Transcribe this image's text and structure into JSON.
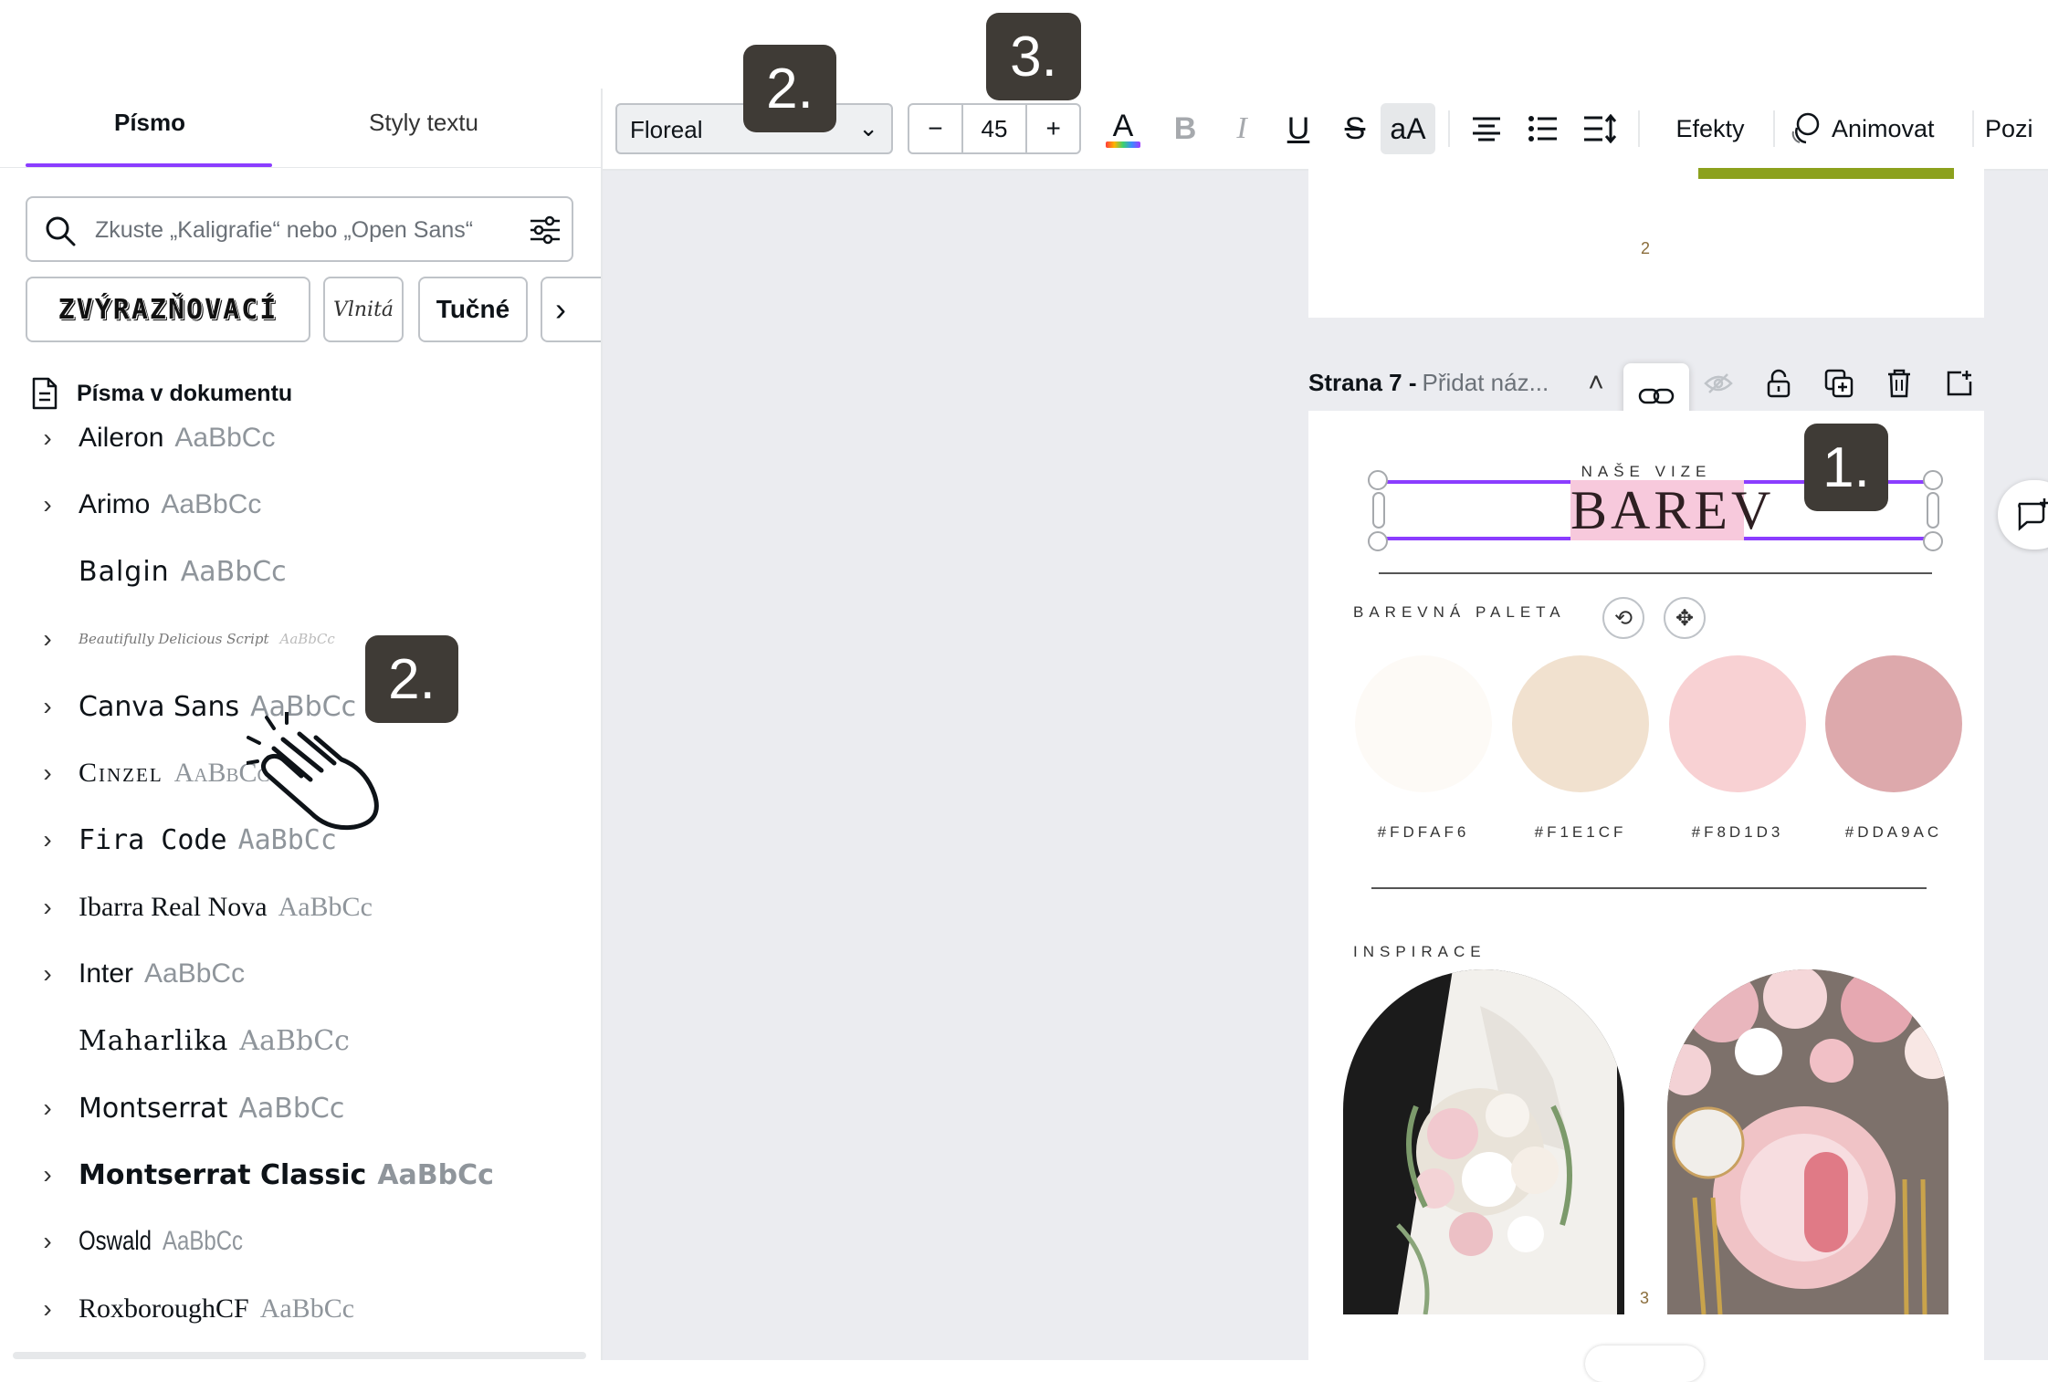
{
  "left_panel": {
    "tabs": [
      {
        "label": "Písmo",
        "active": true
      },
      {
        "label": "Styly textu",
        "active": false
      }
    ],
    "search": {
      "placeholder": "Zkuste „Kaligrafie“ nebo „Open Sans“",
      "value": ""
    },
    "chips": [
      "ZVÝRAZŇOVACÍ",
      "Vlnitá",
      "Tučné"
    ],
    "document_fonts_label": "Písma v dokumentu",
    "fonts": [
      {
        "name": "Aileron",
        "sample": "AaBbCc",
        "expandable": true
      },
      {
        "name": "Arimo",
        "sample": "AaBbCc",
        "expandable": true
      },
      {
        "name": "Balgin",
        "sample": "AaBbCc",
        "expandable": false
      },
      {
        "name": "Beautifully Delicious Script",
        "sample": "AaBbCc",
        "expandable": true
      },
      {
        "name": "Canva Sans",
        "sample": "AaBbCc",
        "expandable": true
      },
      {
        "name": "Cinzel",
        "sample": "AaBbCc",
        "expandable": true
      },
      {
        "name": "Fira Code",
        "sample": "AaBbCc",
        "expandable": true
      },
      {
        "name": "Ibarra Real Nova",
        "sample": "AaBbCc",
        "expandable": true
      },
      {
        "name": "Inter",
        "sample": "AaBbCc",
        "expandable": true
      },
      {
        "name": "Maharlika",
        "sample": "AaBbCc",
        "expandable": false
      },
      {
        "name": "Montserrat",
        "sample": "AaBbCc",
        "expandable": true
      },
      {
        "name": "Montserrat Classic",
        "sample": "AaBbCc",
        "expandable": true
      },
      {
        "name": "Oswald",
        "sample": "AaBbCc",
        "expandable": true
      },
      {
        "name": "RoxboroughCF",
        "sample": "AaBbCc",
        "expandable": true
      }
    ]
  },
  "toolbar": {
    "font_value": "Floreal",
    "size_minus": "−",
    "size_value": "45",
    "size_plus": "+",
    "text_color_glyph": "A",
    "bold_glyph": "B",
    "italic_glyph": "I",
    "underline_glyph": "U",
    "strike_glyph": "S",
    "case_glyph": "aA",
    "effects_label": "Efekty",
    "animate_label": "Animovat",
    "position_label": "Pozi"
  },
  "canvas": {
    "page6_number": "2",
    "page_label": "Strana 7 -",
    "page_name_placeholder": "Přidat náz...",
    "subtitle": "NAŠE VIZE",
    "title": "BAREV",
    "palette_label": "BAREVNÁ PALETA",
    "swatches": [
      {
        "label": "#FDFAF6",
        "color": "#FDFAF6"
      },
      {
        "label": "#F1E1CF",
        "color": "#F1E1CF"
      },
      {
        "label": "#F8D1D3",
        "color": "#F8D1D3"
      },
      {
        "label": "#DDA9AC",
        "color": "#DDA9AC"
      }
    ],
    "inspiration_label": "INSPIRACE",
    "page7_number": "3"
  },
  "badges": {
    "step1": "1.",
    "step2": "2.",
    "step3": "3."
  },
  "colors": {
    "accent": "#8b3dff",
    "badge_bg": "#3f3b36",
    "highlight": "#f7c9dc",
    "page_bar": "#8ca11d"
  }
}
